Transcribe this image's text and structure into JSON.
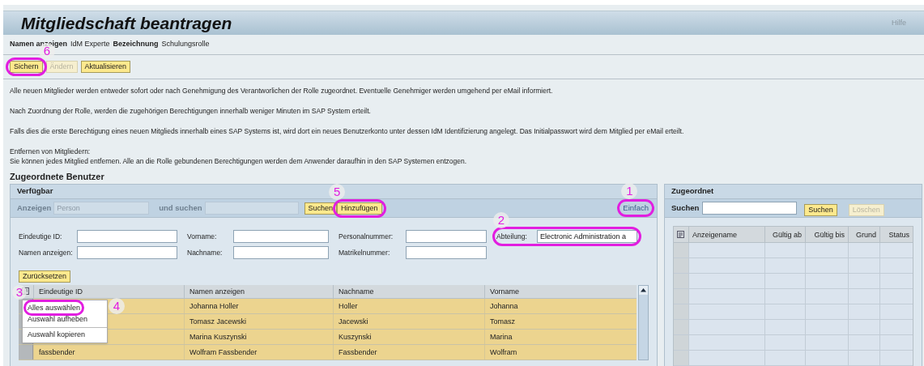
{
  "title": "Mitgliedschaft beantragen",
  "help": "Hilfe",
  "info": [
    {
      "label": "Namen anzeigen",
      "value": "IdM Experte"
    },
    {
      "label": "Bezeichnung",
      "value": "Schulungsrolle"
    }
  ],
  "toolbar": [
    {
      "label": "Sichern",
      "disabled": false,
      "callout": "6"
    },
    {
      "label": "Ändern",
      "disabled": true
    },
    {
      "label": "Aktualisieren",
      "disabled": false
    }
  ],
  "paragraphs": [
    [
      "Alle neuen Mitglieder werden entweder sofort oder nach Genehmigung des Verantworlichen der Rolle zugeordnet. Eventuelle Genehmiger werden umgehend per eMail informiert."
    ],
    [
      "Nach Zuordnung der Rolle, werden die zugehörigen Berechtigungen innerhalb weniger Minuten im SAP System erteilt."
    ],
    [
      "Falls dies die erste Berechtigung eines neuen Mitglieds innerhalb eines SAP Systems ist, wird dort ein neues Benutzerkonto unter dessen IdM Identifizierung angelegt. Das Initialpasswort wird dem Mitglied per eMail erteilt."
    ],
    [
      "Entfernen von Mitgliedern:",
      "Sie können jedes Mitglied entfernen. Alle an die Rolle gebundenen Berechtigungen werden dem Anwender daraufhin in den SAP Systemen entzogen."
    ]
  ],
  "section_title": "Zugeordnete Benutzer",
  "available": {
    "title": "Verfügbar",
    "show_label": "Anzeigen",
    "show_value": "Person",
    "search_label": "und suchen",
    "search_button": {
      "label": "Suchen",
      "disabled": false
    },
    "add_button": {
      "label": "Hinzufügen",
      "disabled": false,
      "callout": "5"
    },
    "mode_link": {
      "label": "Einfach",
      "callout": "1"
    },
    "filter_rows": [
      [
        {
          "label": "Eindeutige ID:"
        },
        {
          "label": "Vorname:"
        },
        {
          "label": "Personalnummer:"
        },
        {
          "label": "Abteilung:",
          "value": "Electronic Administration a",
          "callout": "2"
        }
      ],
      [
        {
          "label": "Namen anzeigen:"
        },
        {
          "label": "Nachname:"
        },
        {
          "label": "Matrikelnummer:"
        }
      ]
    ],
    "reset_button": "Zurücksetzen",
    "selector_callout": "3",
    "columns": [
      "Eindeutige ID",
      "Namen anzeigen",
      "Nachname",
      "Vorname"
    ],
    "rows": [
      {
        "display_name": "Johanna Holler",
        "last_name": "Holler",
        "first_name": "Johanna",
        "selected": true
      },
      {
        "display_name": "Tomasz Jacewski",
        "last_name": "Jacewski",
        "first_name": "Tomasz",
        "selected": true
      },
      {
        "display_name": "Marina Kuszynski",
        "last_name": "Kuszynski",
        "first_name": "Marina",
        "selected": true
      },
      {
        "id": "fassbender",
        "display_name": "Wolfram Fassbender",
        "last_name": "Fassbender",
        "first_name": "Wolfram",
        "selected": true
      }
    ],
    "menu": [
      {
        "label": "Alles auswählen",
        "callout": "4"
      },
      {
        "label": "Auswahl aufheben"
      },
      {
        "label": "Auswahl kopieren"
      }
    ]
  },
  "assigned": {
    "title": "Zugeordnet",
    "search_label": "Suchen",
    "search_button": {
      "label": "Suchen",
      "disabled": false
    },
    "delete_button": {
      "label": "Löschen",
      "disabled": true
    },
    "columns": [
      "Anzeigename",
      "Gültig ab",
      "Gültig bis",
      "Grund",
      "Status"
    ]
  }
}
